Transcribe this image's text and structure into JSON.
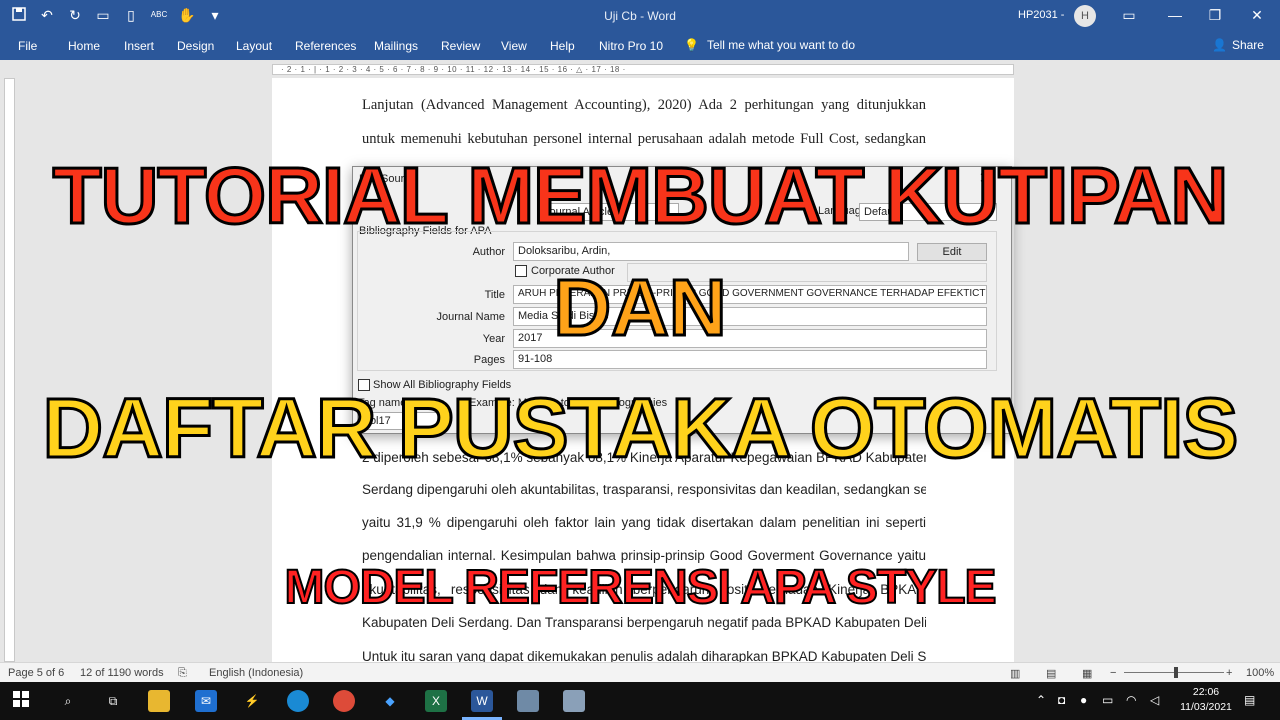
{
  "titlebar": {
    "title": "Uji Cb  -  Word",
    "user": "HP2031 -",
    "avatar_initial": "H",
    "qat_icons": [
      "save-icon",
      "undo-icon",
      "redo-icon",
      "open-icon",
      "new-doc-icon",
      "spelling-icon",
      "touch-mode-icon",
      "customize-icon"
    ]
  },
  "ribbon": {
    "tabs": [
      "File",
      "Home",
      "Insert",
      "Design",
      "Layout",
      "References",
      "Mailings",
      "Review",
      "View",
      "Help",
      "Nitro Pro 10"
    ],
    "tell_me": "Tell me what you want to do",
    "share": "Share"
  },
  "ruler": {
    "text": "· 2 · 1 · | · 1 · 2 · 3 · 4 · 5 · 6 · 7 · 8 · 9 · 10 · 11 · 12 · 13 · 14 · 15 · 16 · △ · 17 · 18 ·"
  },
  "document": {
    "lines_top": [
      "Lanjutan (Advanced Management Accounting), 2020) Ada 2 perhitungan yang ditunjukkan",
      "untuk memenuhi kebutuhan personel internal perusahaan adalah metode Full Cost, sedangkan"
    ],
    "lines_bottom": [
      "2 diperoleh sebesar 68,1% sebanyak 68,1% Kinerja Aparatur Kepegawaian BPKAD Kabupaten Deli",
      "Serdang dipengaruhi oleh akuntabilitas, trasparansi, responsivitas dan keadilan, sedangkan selebihnya",
      "yaitu 31,9 % dipengaruhi oleh faktor lain yang tidak disertakan dalam penelitian ini seperti",
      "pengendalian internal. Kesimpulan bahwa prinsip-prinsip Good Goverment Governance yaitu",
      "akuntabilitas, responsivitas dan keadilan berpengaruh positif terhadap Kinerja BPKAD",
      "Kabupaten Deli Serdang. Dan Transparansi berpengaruh negatif pada BPKAD Kabupaten Deli Serdang.",
      "Untuk itu saran yang dapat dikemukakan penulis adalah diharapkan BPKAD Kabupaten Deli Serdang"
    ]
  },
  "dialog": {
    "title": "Edit Source",
    "source_type": "Journal Article",
    "language_label": "Language",
    "language": "Default",
    "section": "Bibliography Fields for APA",
    "fields": {
      "author_label": "Author",
      "author": "Doloksaribu, Ardin,",
      "edit_button": "Edit",
      "corporate_author": "Corporate Author",
      "title_label": "Title",
      "title": "ARUH PENERAPAN PRINSIP-PRINSIP GOOD GOVERNMENT GOVERNANCE TERHADAP EFEKTICTIVITAS",
      "journal_label": "Journal Name",
      "journal": "Media Studi Bisnis",
      "year_label": "Year",
      "year": "2017",
      "pages_label": "Pages",
      "pages": "91-108"
    },
    "show_all": "Show All Bibliography Fields",
    "tag_label": "Tag name",
    "example_label": "Example: Most up-to-date Bibliographies",
    "tag_value": "Dol17"
  },
  "overlay": {
    "line1": "TUTORIAL MEMBUAT KUTIPAN",
    "line2": "DAN",
    "line3": "DAFTAR PUSTAKA OTOMATIS",
    "line4": "MODEL REFERENSI APA STYLE"
  },
  "statusbar": {
    "page": "Page 5 of 6",
    "words": "12 of 1190 words",
    "language": "English (Indonesia)",
    "zoom": "100%"
  },
  "taskbar": {
    "time": "22:06",
    "date": "11/03/2021",
    "apps": [
      "start-icon",
      "search-icon",
      "task-view-icon",
      "file-explorer-icon",
      "mail-icon",
      "winamp-icon",
      "edge-icon",
      "chrome-icon",
      "dropbox-icon",
      "excel-icon",
      "word-icon",
      "app-icon",
      "app2-icon"
    ]
  },
  "colors": {
    "ribbon_blue": "#2b579a",
    "overlay_red": "#f8341a",
    "overlay_orange": "#ffa319",
    "overlay_yellow": "#ffd21c"
  }
}
